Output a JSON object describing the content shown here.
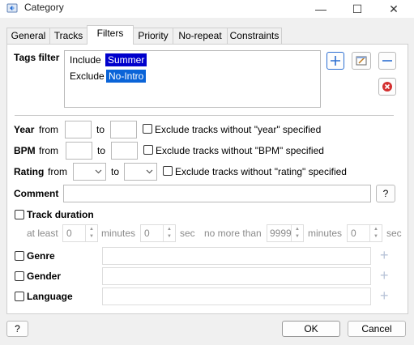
{
  "window": {
    "title": "Category",
    "minimize": "—",
    "maximize": "☐",
    "close": "✕"
  },
  "tabs": [
    "General",
    "Tracks",
    "Filters",
    "Priority",
    "No-repeat",
    "Constraints"
  ],
  "tags_filter": {
    "label": "Tags filter",
    "rows": [
      {
        "mode": "Include",
        "tag": "Summer"
      },
      {
        "mode": "Exclude",
        "tag": "No-Intro"
      }
    ]
  },
  "year": {
    "label": "Year",
    "from": "from",
    "to": "to",
    "from_value": "",
    "to_value": "",
    "exclude": "Exclude tracks without \"year\" specified"
  },
  "bpm": {
    "label": "BPM",
    "from": "from",
    "to": "to",
    "from_value": "",
    "to_value": "",
    "exclude": "Exclude tracks without \"BPM\" specified"
  },
  "rating": {
    "label": "Rating",
    "from": "from",
    "to": "to",
    "from_value": "",
    "to_value": "",
    "exclude": "Exclude tracks without \"rating\" specified"
  },
  "comment": {
    "label": "Comment",
    "value": "",
    "help": "?"
  },
  "track_duration": {
    "label": "Track duration",
    "at_least": "at least",
    "min1": "0",
    "minutes1": "minutes",
    "sec1": "0",
    "sec_label1": "sec",
    "no_more_than": "no more than",
    "min2": "9999",
    "minutes2": "minutes",
    "sec2": "0",
    "sec_label2": "sec"
  },
  "genre": {
    "label": "Genre",
    "value": ""
  },
  "gender": {
    "label": "Gender",
    "value": ""
  },
  "language": {
    "label": "Language",
    "value": ""
  },
  "footer": {
    "help": "?",
    "ok": "OK",
    "cancel": "Cancel"
  },
  "colors": {
    "accent": "#0a64d8",
    "selection": "#0000cc",
    "remove": "#d32f2f"
  }
}
